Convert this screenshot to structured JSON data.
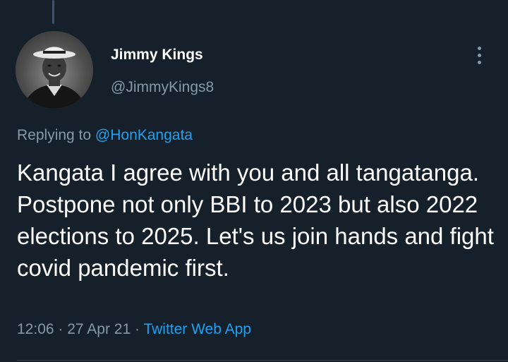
{
  "tweet": {
    "user": {
      "display_name": "Jimmy Kings",
      "handle": "@JimmyKings8"
    },
    "reply": {
      "prefix": "Replying to ",
      "mention": "@HonKangata"
    },
    "text": "Kangata I agree with you and all tangatanga. Postpone not only BBI to 2023 but also 2022 elections to 2025. Let's us join hands and fight covid pandemic first.",
    "meta": {
      "time": "12:06",
      "separator1": " · ",
      "date": "27 Apr 21",
      "separator2": " · ",
      "source": "Twitter Web App"
    }
  },
  "icons": {
    "more": "more-vertical-icon"
  },
  "colors": {
    "background": "#15202b",
    "primary_text": "#ffffff",
    "secondary_text": "#8899a6",
    "accent": "#1da1f2",
    "divider": "#38444d"
  }
}
